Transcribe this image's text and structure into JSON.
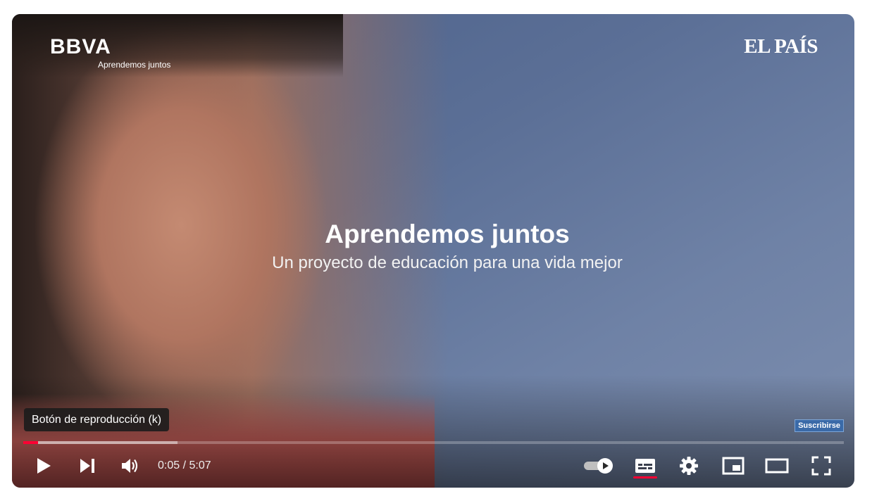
{
  "video": {
    "headline": "Aprendemos juntos",
    "subline": "Un proyecto de educación para una vida mejor"
  },
  "overlay": {
    "left_logo": "BBVA",
    "left_logo_sub": "Aprendemos juntos",
    "right_logo": "EL PAÍS",
    "subscribe_label": "Suscribirse"
  },
  "tooltip": {
    "text": "Botón de reproducción (k)"
  },
  "player": {
    "time_display": "0:05 / 5:07",
    "progress_fraction": 0.018,
    "buffered_fraction": 0.188,
    "autoplay_on": true,
    "captions_on": true
  },
  "colors": {
    "accent": "#ff0033",
    "tooltip_bg": "#1c1c1c",
    "subscribe_bg": "#3a6aa8"
  },
  "icons": {
    "play": "play-icon",
    "next": "next-icon",
    "volume": "volume-icon",
    "autoplay": "autoplay-toggle-icon",
    "captions": "captions-icon",
    "settings": "gear-icon",
    "miniplayer": "miniplayer-icon",
    "theater": "theater-mode-icon",
    "fullscreen": "fullscreen-icon"
  }
}
